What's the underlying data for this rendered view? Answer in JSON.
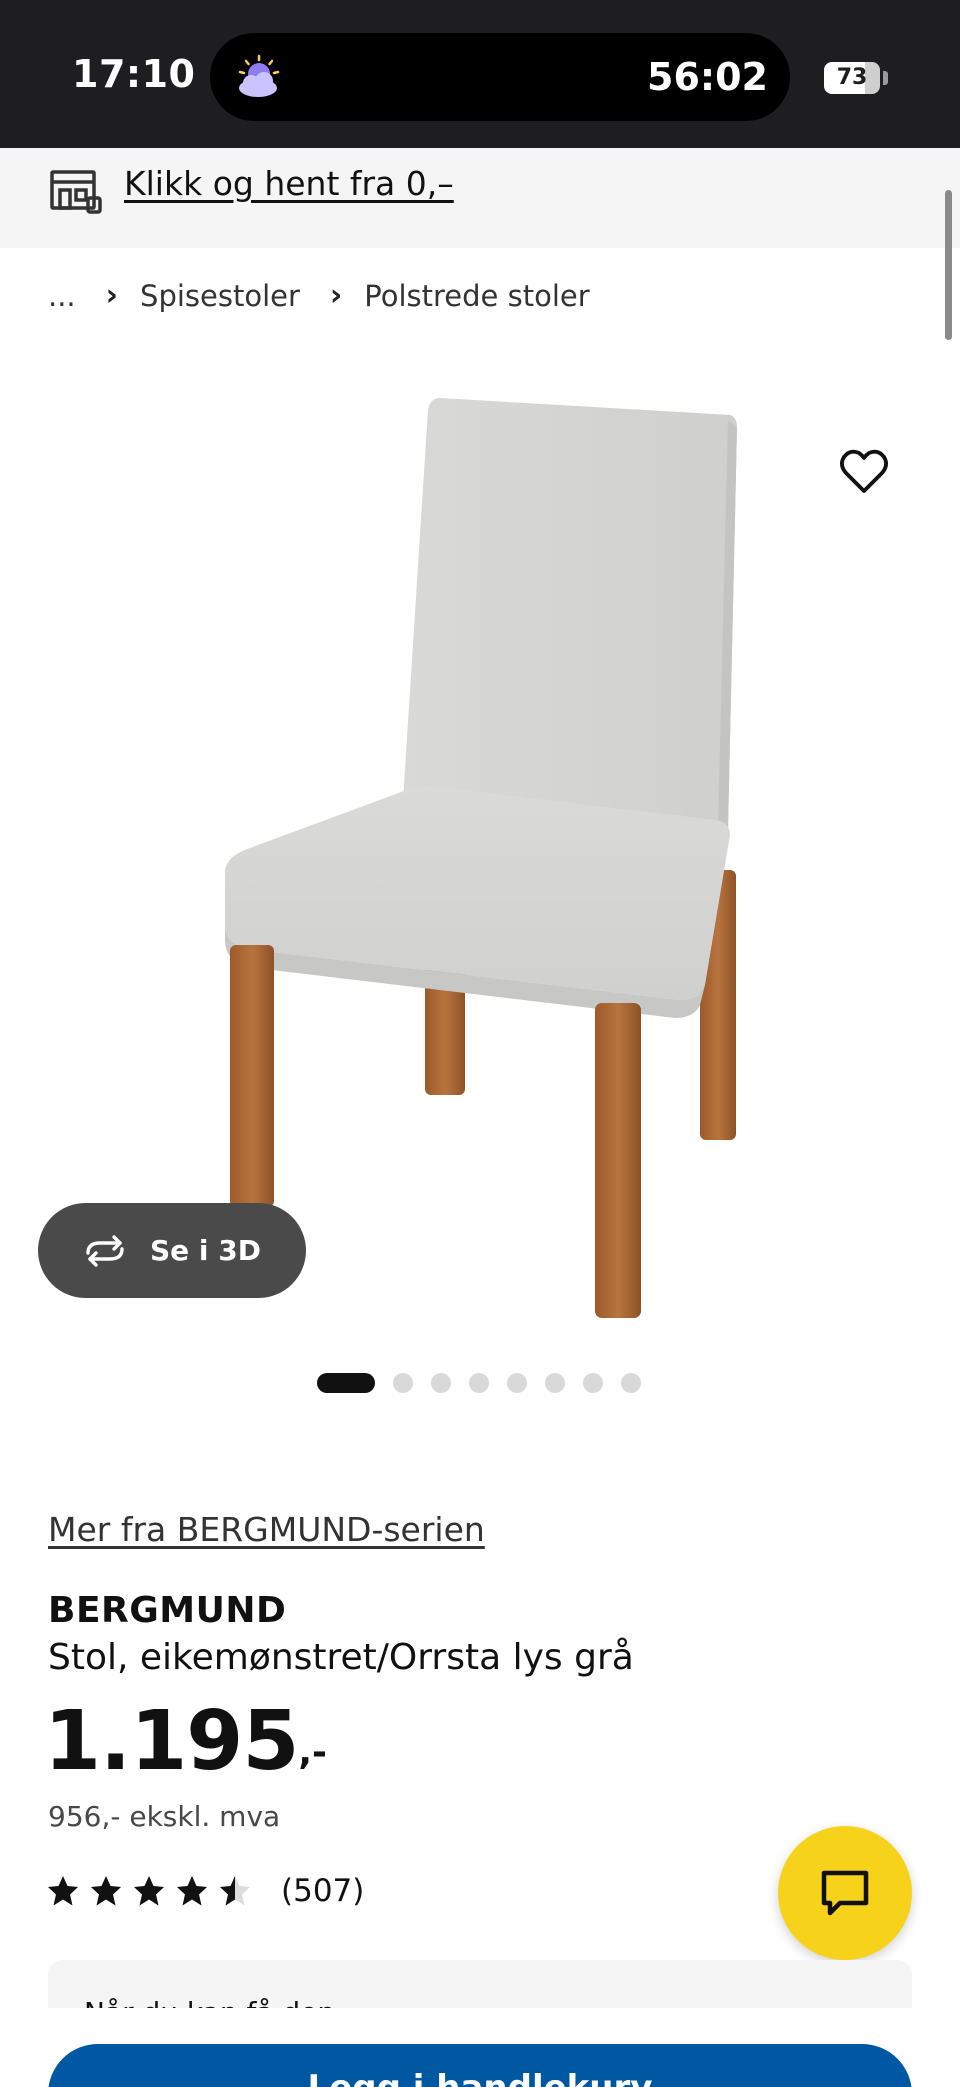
{
  "status_bar": {
    "time": "17:10",
    "timer": "56:02",
    "battery_level": "73",
    "battery_fraction": 0.73,
    "weather_icon": "night-cloud-icon"
  },
  "store_banner": {
    "icon": "store-pickup-icon",
    "link": "Klikk og hent fra 0,–"
  },
  "breadcrumb": {
    "ellipsis": "...",
    "items": [
      "Spisestoler",
      "Polstrede stoler"
    ]
  },
  "gallery": {
    "see_3d_label": "Se i 3D",
    "see_3d_icon": "rotate-3d-icon",
    "favorite_icon": "heart-icon",
    "dots_total": 8,
    "active_index": 0
  },
  "product": {
    "series_link": "Mer fra BERGMUND-serien",
    "name": "BERGMUND",
    "description": "Stol, eikemønstret/Orrsta lys grå",
    "price": "1.195",
    "price_suffix": ",-",
    "price_ex_vat": "956,- ekskl. mva",
    "rating": 4.5,
    "rating_max": 5,
    "review_count": "(507)"
  },
  "chat": {
    "icon": "chat-bubble-icon"
  },
  "colors": {
    "status_bar": "#1e1e21",
    "chat_fab": "#f7d21b",
    "primary_button": "#0058a3",
    "banner_bg": "#f5f5f5"
  },
  "bottom": {
    "card_text": "Når du kan få den",
    "cart_label": "Legg i handlekurv"
  }
}
